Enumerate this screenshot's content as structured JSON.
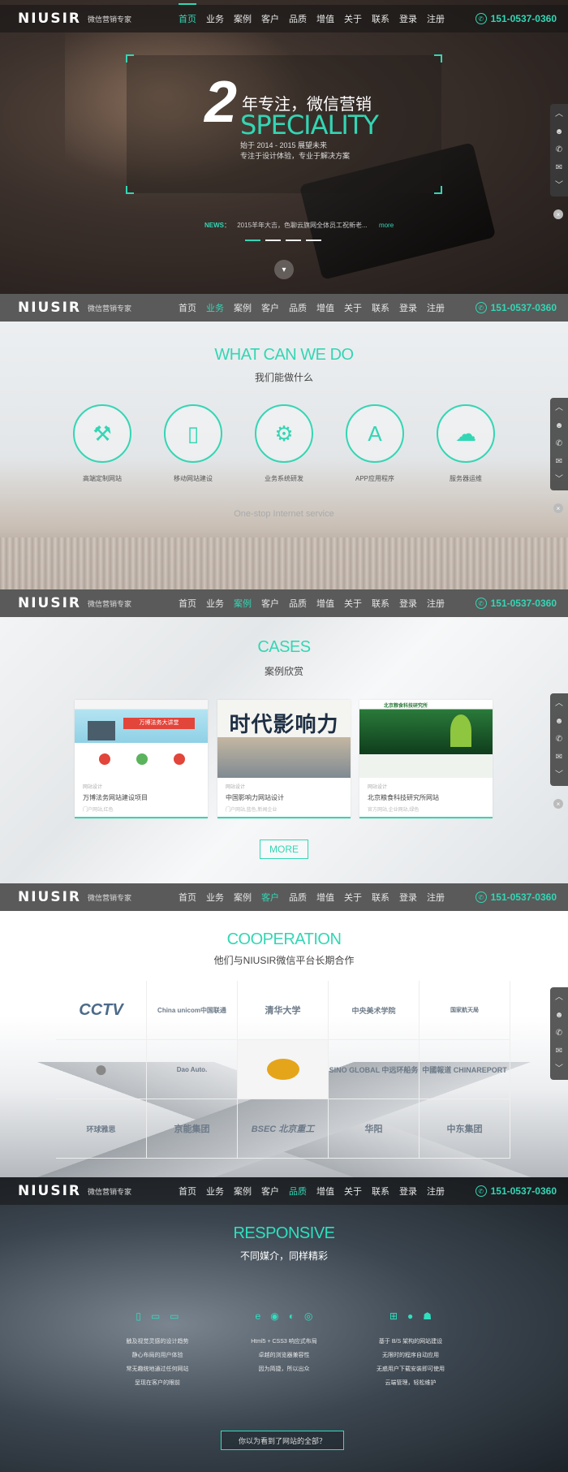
{
  "nav": {
    "logo": "NIUSIR",
    "tagline": "微信营销专家",
    "items": [
      "首页",
      "业务",
      "案例",
      "客户",
      "品质",
      "增值",
      "关于",
      "联系",
      "登录",
      "注册"
    ],
    "phone": "151-0537-0360"
  },
  "sidebar": {
    "items": [
      "︿",
      "☻",
      "✆",
      "✉",
      "﹀"
    ],
    "close": "×"
  },
  "hero": {
    "number": "2",
    "title_cn": "年专注，微信营销",
    "title_en": "SPECIALITY",
    "sub1": "始于 2014 - 2015 展望未来",
    "sub2": "专注于设计体验，专业于解决方案",
    "news_label": "NEWS：",
    "news_text": "2015羊年大吉，色聊云旗网全体员工祝新老...",
    "news_more": "more"
  },
  "services": {
    "title": "WHAT CAN WE DO",
    "subtitle": "我们能做什么",
    "items": [
      {
        "label": "高端定制网站",
        "icon": "tools-icon"
      },
      {
        "label": "移动网站建设",
        "icon": "mobile-icon"
      },
      {
        "label": "业务系统研发",
        "icon": "monitor-gear-icon"
      },
      {
        "label": "APP应用程序",
        "icon": "app-store-icon"
      },
      {
        "label": "服务器运维",
        "icon": "cloud-server-icon"
      }
    ],
    "tagline": "One-stop Internet service"
  },
  "cases": {
    "title": "CASES",
    "subtitle": "案例欣赏",
    "items": [
      {
        "category": "网站设计",
        "name": "万博法务网站建设项目",
        "tags": "门户网站,红色"
      },
      {
        "category": "网站设计",
        "name": "中国影响力网站设计",
        "tags": "门户网站,蓝色,新闻企业"
      },
      {
        "category": "网站设计",
        "name": "北京粮食科技研究所网站",
        "tags": "官方网站,企业网站,绿色"
      }
    ],
    "card_titles": [
      "万博法务大讲堂",
      "时代影响力",
      "北京粮食科技研究所"
    ],
    "more": "MORE"
  },
  "coop": {
    "title": "COOPERATION",
    "subtitle": "他们与NIUSIR微信平台长期合作",
    "logos": [
      "CCTV",
      "China unicom中国联通",
      "清华大学",
      "中央美术学院",
      "国家航天局",
      "",
      "Dao Auto.",
      "",
      "SINO GLOBAL 中远环船务",
      "中國報道 CHINAREPORT",
      "环球雅思",
      "京能集团",
      "BSEC 北京重工",
      "华阳",
      "中东集团"
    ]
  },
  "responsive": {
    "title": "RESPONSIVE",
    "subtitle": "不同媒介，同样精彩",
    "col1": [
      "触及视觉灵感的设计趋势",
      "静心布局的用户体验",
      "常无趣统地通过任何网站",
      "呈现在客户的眼前"
    ],
    "col2": [
      "Html5 + CSS3 响应式布局",
      "卓越的浏览器兼容性",
      "因为简捷，所以出众"
    ],
    "col3": [
      "基于 B/S 架构的网站建设",
      "无限时的程序自动应用",
      "无惑用户下载安装即可使用",
      "云端管理，轻松维护"
    ],
    "button": "你以为看到了网站的全部？"
  },
  "colors": {
    "accent": "#33d6b4"
  }
}
